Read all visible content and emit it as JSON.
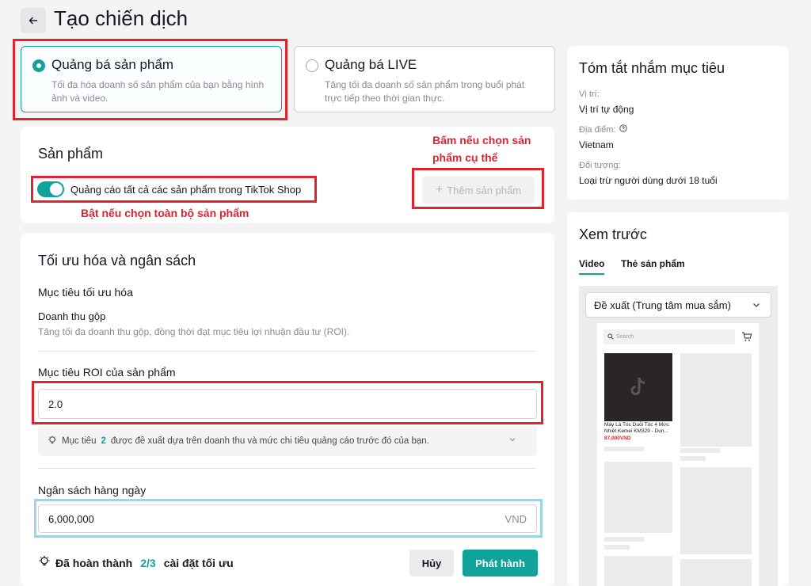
{
  "header": {
    "title": "Tạo chiến dịch"
  },
  "objectives": [
    {
      "title": "Quảng bá sản phẩm",
      "desc": "Tối đa hóa doanh số sản phẩm của bạn bằng hình ảnh và video."
    },
    {
      "title": "Quảng bá LIVE",
      "desc": "Tăng tối đa doanh số sản phẩm trong buổi phát trực tiếp theo thời gian thực."
    }
  ],
  "products": {
    "title": "Sản phẩm",
    "toggle_label": "Quảng cáo tất cả các sản phẩm trong TikTok Shop",
    "add_button": "Thêm sản phẩm"
  },
  "annotations": {
    "specific": "Bấm nếu chọn sản phẩm cụ thể",
    "all": "Bật nếu chọn toàn bộ sản phẩm"
  },
  "optimization": {
    "title": "Tối ưu hóa và ngân sách",
    "goal_label": "Mục tiêu tối ưu hóa",
    "goal_value": "Doanh thu gộp",
    "goal_desc": "Tăng tối đa doanh thu gộp, đồng thời đạt mục tiêu lợi nhuận đầu tư (ROI).",
    "roi_label": "Mục tiêu ROI của sản phẩm",
    "roi_value": "2.0",
    "hint_prefix": "Mục tiêu",
    "hint_num": "2",
    "hint_suffix": "được đề xuất dựa trên doanh thu và mức chi tiêu quảng cáo trước đó của bạn.",
    "budget_label": "Ngân sách hàng ngày",
    "budget_value": "6,000,000",
    "budget_currency": "VND"
  },
  "footer": {
    "progress_prefix": "Đã hoàn thành",
    "progress_value": "2/3",
    "progress_suffix": "cài đặt tối ưu",
    "cancel": "Hủy",
    "publish": "Phát hành"
  },
  "summary": {
    "title": "Tóm tắt nhắm mục tiêu",
    "placement_label": "Vị trí:",
    "placement_value": "Vị trí tự động",
    "location_label": "Địa điểm:",
    "location_value": "Vietnam",
    "audience_label": "Đối tượng:",
    "audience_value": "Loại trừ người dùng dưới 18 tuổi"
  },
  "preview": {
    "title": "Xem trước",
    "tabs": [
      "Video",
      "Thẻ sản phẩm"
    ],
    "dropdown": "Đề xuất (Trung tâm mua sắm)",
    "search_placeholder": "Search",
    "product_name": "Máy Là Tóc Duỗi Tóc 4 Mức Nhiệt Kemei KM329 - Dụn...",
    "product_price": "87,000VND"
  },
  "colors": {
    "accent": "#0fa39a",
    "annotation_red": "#e0232e",
    "highlight_blue": "#9fd4e6"
  }
}
